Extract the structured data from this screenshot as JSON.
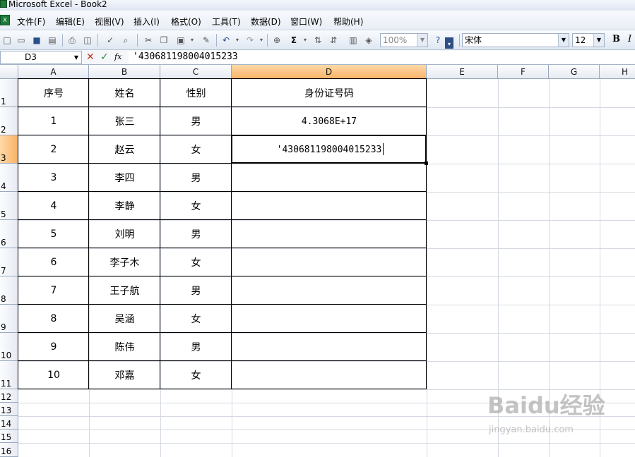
{
  "window": {
    "title": "Microsoft Excel - Book2"
  },
  "menu": [
    "文件(F)",
    "编辑(E)",
    "视图(V)",
    "插入(I)",
    "格式(O)",
    "工具(T)",
    "数据(D)",
    "窗口(W)",
    "帮助(H)"
  ],
  "toolbar": {
    "zoom": "100%",
    "font_name": "宋体",
    "font_size": "12",
    "bold_label": "B",
    "italic_label": "I"
  },
  "formula_bar": {
    "name_box": "D3",
    "content": "'430681198004015233",
    "fx_label": "fx"
  },
  "columns": [
    "A",
    "B",
    "C",
    "D",
    "E",
    "F",
    "G",
    "H"
  ],
  "active": {
    "column": "D",
    "row": "3"
  },
  "rows": [
    "1",
    "2",
    "3",
    "4",
    "5",
    "6",
    "7",
    "8",
    "9",
    "10",
    "11",
    "12",
    "13",
    "14",
    "15",
    "16"
  ],
  "table": {
    "headers": [
      "序号",
      "姓名",
      "性别",
      "身份证号码"
    ],
    "body": [
      [
        "1",
        "张三",
        "男",
        "4.3068E+17"
      ],
      [
        "2",
        "赵云",
        "女",
        "'430681198004015233"
      ],
      [
        "3",
        "李四",
        "男",
        ""
      ],
      [
        "4",
        "李静",
        "女",
        ""
      ],
      [
        "5",
        "刘明",
        "男",
        ""
      ],
      [
        "6",
        "李子木",
        "女",
        ""
      ],
      [
        "7",
        "王子航",
        "男",
        ""
      ],
      [
        "8",
        "吴涵",
        "女",
        ""
      ],
      [
        "9",
        "陈伟",
        "男",
        ""
      ],
      [
        "10",
        "邓嘉",
        "女",
        ""
      ]
    ]
  },
  "watermark": {
    "brand": "Baidu经验",
    "url": "jingyan.baidu.com"
  }
}
